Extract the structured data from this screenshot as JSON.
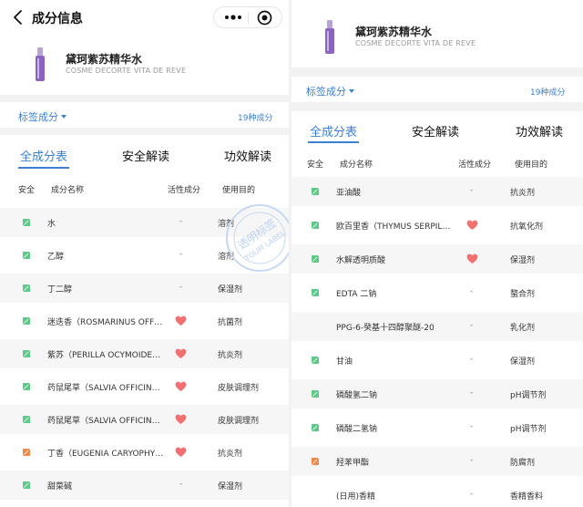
{
  "nav": {
    "title": "成分信息"
  },
  "product": {
    "name": "黛珂紫苏精华水",
    "name_en": "COSME DECORTE VITA DE REVE"
  },
  "labels": {
    "title": "标签成分",
    "count": "19种成分"
  },
  "tabs": [
    {
      "label": "全成分表",
      "active": true
    },
    {
      "label": "安全解读",
      "active": false
    },
    {
      "label": "功效解读",
      "active": false
    }
  ],
  "table_header": {
    "safety": "安全",
    "name": "成分名称",
    "active": "活性成分",
    "purpose": "使用目的"
  },
  "left_rows": [
    {
      "name": "水",
      "active": "-",
      "purpose": "溶剂",
      "safety": "green"
    },
    {
      "name": "乙醇",
      "active": "-",
      "purpose": "溶剂",
      "safety": "green"
    },
    {
      "name": "丁二醇",
      "active": "-",
      "purpose": "保湿剂",
      "safety": "green"
    },
    {
      "name": "迷迭香（ROSMARINUS OFF…",
      "active": "heart",
      "purpose": "抗菌剂",
      "safety": "green"
    },
    {
      "name": "紫苏（PERILLA OCYMOIDE…",
      "active": "heart",
      "purpose": "抗炎剂",
      "safety": "green"
    },
    {
      "name": "药鼠尾草（SALVIA OFFICIN…",
      "active": "heart",
      "purpose": "皮肤调理剂",
      "safety": "green"
    },
    {
      "name": "药鼠尾草（SALVIA OFFICIN…",
      "active": "heart",
      "purpose": "皮肤调理剂",
      "safety": "green"
    },
    {
      "name": "丁香（EUGENIA CARYOPHY…",
      "active": "heart",
      "purpose": "抗炎剂",
      "safety": "orange"
    },
    {
      "name": "甜菜碱",
      "active": "-",
      "purpose": "保湿剂",
      "safety": "green"
    }
  ],
  "right_rows": [
    {
      "name": "亚油酸",
      "active": "-",
      "purpose": "抗炎剂",
      "safety": "green"
    },
    {
      "name": "欧百里香（THYMUS SERPIL…",
      "active": "heart",
      "purpose": "抗氧化剂",
      "safety": "green"
    },
    {
      "name": "水解透明质酸",
      "active": "heart",
      "purpose": "保湿剂",
      "safety": "green"
    },
    {
      "name": "EDTA 二钠",
      "active": "-",
      "purpose": "螯合剂",
      "safety": "green"
    },
    {
      "name": "PPG-6-癸基十四醇聚醚-20",
      "active": "-",
      "purpose": "乳化剂",
      "safety": "none"
    },
    {
      "name": "甘油",
      "active": "-",
      "purpose": "保湿剂",
      "safety": "green"
    },
    {
      "name": "磷酸氢二钠",
      "active": "-",
      "purpose": "pH调节剂",
      "safety": "green"
    },
    {
      "name": "磷酸二氢钠",
      "active": "-",
      "purpose": "pH调节剂",
      "safety": "green"
    },
    {
      "name": "羟苯甲酯",
      "active": "-",
      "purpose": "防腐剂",
      "safety": "orange"
    },
    {
      "name": "(日用)香精",
      "active": "-",
      "purpose": "香精香料",
      "safety": "none"
    }
  ],
  "watermark": {
    "text_cn": "透明标签",
    "text_en": "TOUM LABEL"
  },
  "colors": {
    "accent": "#3d7fd0",
    "safe_green": "#5fc98a",
    "warn_orange": "#f08a4b",
    "heart": "#f2706f"
  }
}
